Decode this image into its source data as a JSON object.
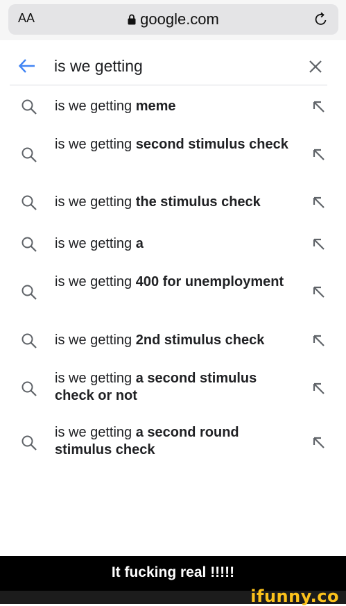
{
  "browser": {
    "text_size_label": "AA",
    "host": "google.com"
  },
  "search": {
    "query": "is we getting"
  },
  "suggestions": [
    {
      "prefix": "is we getting ",
      "bold": "meme"
    },
    {
      "prefix": "is we getting ",
      "bold": "second stimulus check"
    },
    {
      "prefix": "is we getting ",
      "bold": "the stimulus check"
    },
    {
      "prefix": "is we getting ",
      "bold": "a"
    },
    {
      "prefix": "is we getting ",
      "bold": "400 for unemployment"
    },
    {
      "prefix": "is we getting ",
      "bold": "2nd stimulus check"
    },
    {
      "prefix": "is we getting ",
      "bold": "a second stimulus check or not"
    },
    {
      "prefix": "is we getting ",
      "bold": "a second round stimulus check"
    }
  ],
  "caption": "It fucking real !!!!!",
  "watermark": "ifunny.co",
  "icons": [
    "text-size-icon",
    "lock-icon",
    "reload-icon",
    "back-arrow-icon",
    "clear-icon",
    "search-icon",
    "fill-arrow-icon"
  ],
  "colors": {
    "accent": "#4285f4",
    "icon_gray": "#5f6368",
    "brand": "#fcc21b"
  }
}
